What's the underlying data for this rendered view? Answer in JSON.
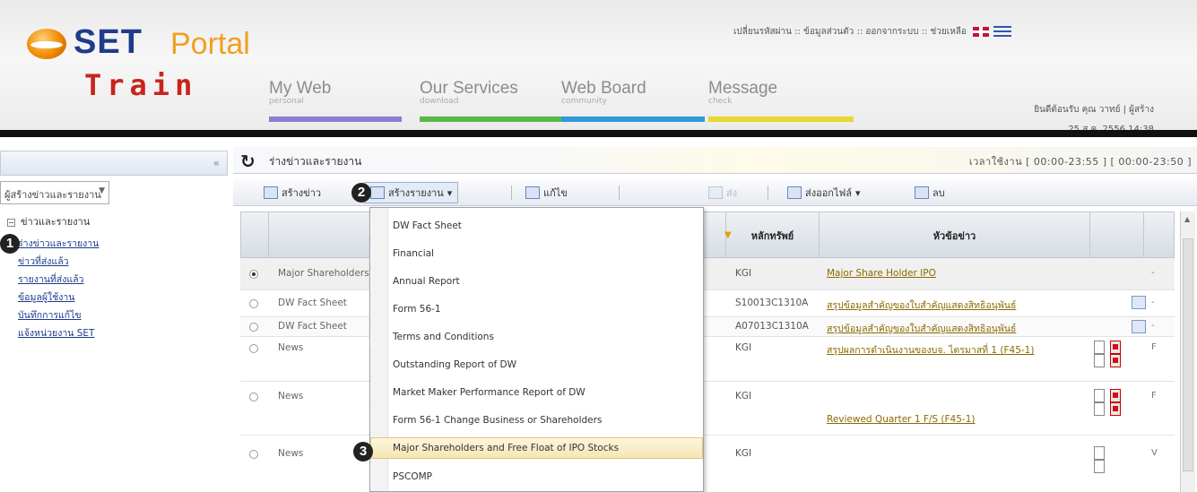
{
  "brand": {
    "set": "SET",
    "portal": "Portal",
    "train": "Train"
  },
  "top_links": "เปลี่ยนรหัสผ่าน :: ข้อมูลส่วนตัว :: ออกจากระบบ :: ช่วยเหลือ",
  "nav": [
    {
      "title": "My Web",
      "sub": "personal",
      "color": "#8a7fd0"
    },
    {
      "title": "Our Services",
      "sub": "download",
      "color": "#58b848"
    },
    {
      "title": "Web Board",
      "sub": "community",
      "color": "#2e9ad8"
    },
    {
      "title": "Message",
      "sub": "check",
      "color": "#e8d830"
    }
  ],
  "user": {
    "line1": "ยินดีต้อนรับ คุณ วาทย์ | ผู้สร้าง",
    "line2": "25 ส.ค. 2556 14:38"
  },
  "left": {
    "select_value": "ผู้สร้างข่าวและรายงาน",
    "root": "ข่าวและรายงาน",
    "items": [
      "ร่างข่าวและรายงาน",
      "ข่าวที่ส่งแล้ว",
      "รายงานที่ส่งแล้ว",
      "ข้อมูลผู้ใช้งาน",
      "บันทึกการแก้ไข",
      "แจ้งหน่วยงาน SET"
    ]
  },
  "main": {
    "title": "ร่างข่าวและรายงาน",
    "time": "เวลาใช้งาน  [ 00:00-23:55 ] [ 00:00-23:50 ]"
  },
  "toolbar": {
    "create_news": "สร้างข่าว",
    "create_report": "สร้างรายงาน",
    "edit": "แก้ไข",
    "send": "ส่ง",
    "submit": "ส่งออกไฟล์",
    "delete": "ลบ"
  },
  "table": {
    "col_security": "หลักทรัพย์",
    "col_headline": "หัวข้อข่าว",
    "rows": [
      {
        "type": "Major Shareholders",
        "sec": "KGI",
        "head": "Major Share Holder IPO",
        "tail": "-"
      },
      {
        "type": "DW Fact Sheet",
        "sec": "S10013C1310A",
        "head": "สรุปข้อมูลสำคัญของใบสำคัญแสดงสิทธิอนุพันธ์",
        "tail": "-"
      },
      {
        "type": "DW Fact Sheet",
        "sec": "A07013C1310A",
        "head": "สรุปข้อมูลสำคัญของใบสำคัญแสดงสิทธิอนุพันธ์",
        "tail": "-"
      },
      {
        "type": "News",
        "sec": "KGI",
        "head": "สรุปผลการดำเนินงานของบจ. ไตรมาสที่ 1 (F45-1)",
        "tail": "F"
      },
      {
        "type": "News",
        "sec": "KGI",
        "head": "Reviewed Quarter 1 F/S (F45-1)",
        "tail": "F"
      },
      {
        "type": "News",
        "sec": "KGI",
        "head": "",
        "tail": "V"
      }
    ]
  },
  "dropdown": [
    "DW Fact Sheet",
    "Financial",
    "Annual Report",
    "Form 56-1",
    "Terms and Conditions",
    "Outstanding Report of DW",
    "Market Maker Performance Report of DW",
    "Form 56-1 Change Business or Shareholders",
    "Major Shareholders and Free Float of IPO Stocks",
    "PSCOMP"
  ],
  "badges": [
    "1",
    "2",
    "3"
  ]
}
